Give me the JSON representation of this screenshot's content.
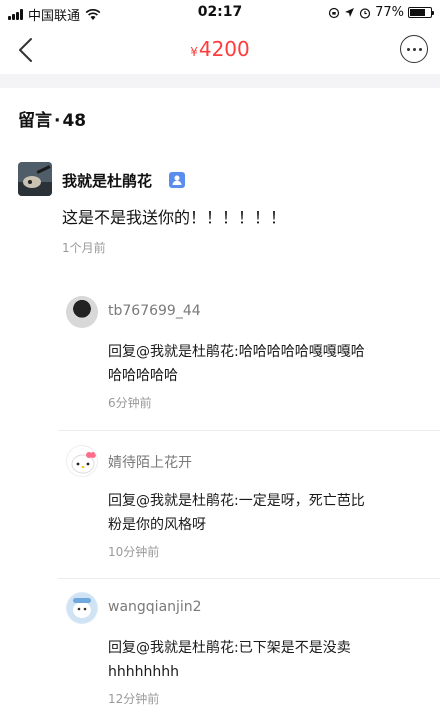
{
  "status_bar": {
    "carrier": "中国联通",
    "time": "02:17",
    "battery": "77%",
    "battery_level": 0.77,
    "icons": [
      "signal-icon",
      "wifi-icon",
      "rotation-lock-icon",
      "location-icon",
      "alarm-icon",
      "battery-icon"
    ]
  },
  "nav": {
    "currency": "¥",
    "price": "4200",
    "back_icon": "chevron-left-icon",
    "more_icon": "more-icon",
    "accent": "#ff3b3b"
  },
  "comments_header": {
    "label": "留言",
    "separator": "·",
    "count": "48"
  },
  "main_comment": {
    "author": "我就是杜鹃花",
    "text": "这是不是我送你的！！！！！！",
    "time": "1个月前"
  },
  "replies": [
    {
      "author": "tb767699_44",
      "line1": "回复@我就是杜鹃花:哈哈哈哈哈嘎嘎嘎哈",
      "line2": "哈哈哈哈哈",
      "time": "6分钟前"
    },
    {
      "author": "婧待陌上花开",
      "line1": "回复@我就是杜鹃花:一定是呀，死亡芭比",
      "line2": "粉是你的风格呀",
      "time": "10分钟前"
    },
    {
      "author": "wangqianjin2",
      "line1": "回复@我就是杜鹃花:已下架是不是没卖",
      "line2": "hhhhhhhh",
      "time": "12分钟前"
    }
  ]
}
